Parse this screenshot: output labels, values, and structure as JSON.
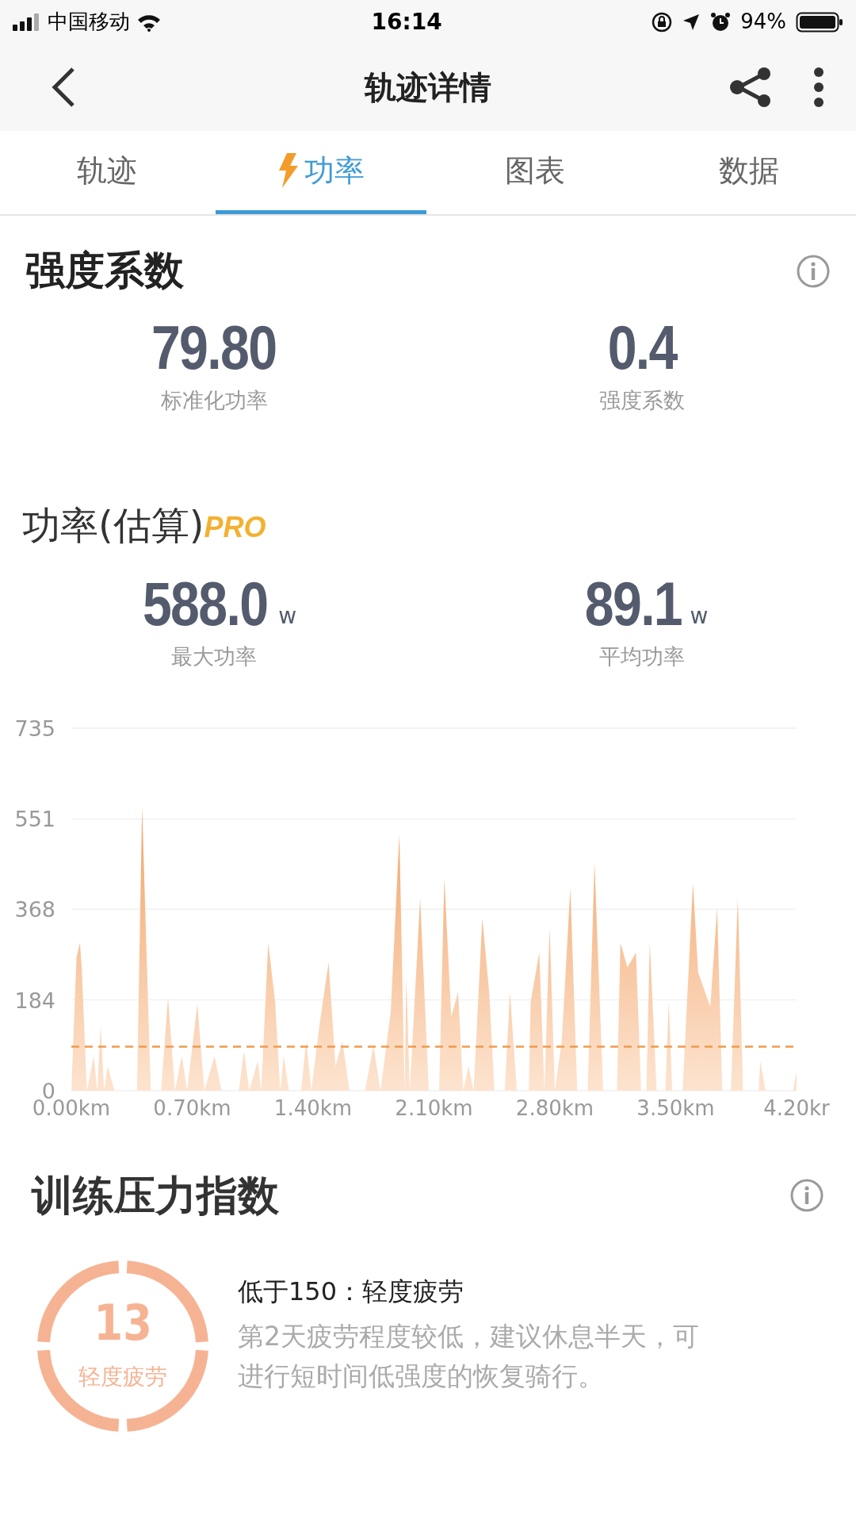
{
  "status_bar": {
    "carrier": "中国移动",
    "time": "16:14",
    "battery": "94%"
  },
  "header": {
    "title": "轨迹详情"
  },
  "tabs": [
    {
      "label": "轨迹",
      "selected": false
    },
    {
      "label": "功率",
      "selected": true
    },
    {
      "label": "图表",
      "selected": false
    },
    {
      "label": "数据",
      "selected": false
    }
  ],
  "intensity": {
    "title": "强度系数",
    "metrics": [
      {
        "value": "79.80",
        "label": "标准化功率"
      },
      {
        "value": "0.4",
        "label": "强度系数"
      }
    ]
  },
  "power": {
    "title": "功率(估算)",
    "badge": "PRO",
    "metrics": [
      {
        "value": "588.0",
        "unit": "w",
        "label": "最大功率"
      },
      {
        "value": "89.1",
        "unit": "w",
        "label": "平均功率"
      }
    ],
    "chart_data": {
      "type": "area",
      "xlim": [
        0,
        4.2
      ],
      "ylim": [
        0,
        735
      ],
      "xticks": [
        {
          "value": 0,
          "label": "0.00km"
        },
        {
          "value": 0.7,
          "label": "0.70km"
        },
        {
          "value": 1.4,
          "label": "1.40km"
        },
        {
          "value": 2.1,
          "label": "2.10km"
        },
        {
          "value": 2.8,
          "label": "2.80km"
        },
        {
          "value": 3.5,
          "label": "3.50km"
        },
        {
          "value": 4.2,
          "label": "4.20kr"
        }
      ],
      "yticks": [
        0,
        184,
        368,
        551,
        735
      ],
      "x": [
        0,
        0.03,
        0.05,
        0.06,
        0.09,
        0.13,
        0.15,
        0.17,
        0.19,
        0.21,
        0.25,
        0.38,
        0.41,
        0.46,
        0.52,
        0.56,
        0.6,
        0.64,
        0.67,
        0.73,
        0.77,
        0.83,
        0.87,
        0.97,
        1.0,
        1.03,
        1.08,
        1.1,
        1.14,
        1.18,
        1.21,
        1.23,
        1.26,
        1.33,
        1.36,
        1.39,
        1.44,
        1.49,
        1.53,
        1.57,
        1.61,
        1.7,
        1.75,
        1.79,
        1.85,
        1.9,
        1.93,
        1.94,
        1.96,
        2.02,
        2.07,
        2.13,
        2.16,
        2.2,
        2.24,
        2.27,
        2.3,
        2.33,
        2.38,
        2.42,
        2.45,
        2.51,
        2.54,
        2.58,
        2.65,
        2.66,
        2.71,
        2.74,
        2.77,
        2.8,
        2.84,
        2.89,
        2.93,
        2.99,
        3.03,
        3.08,
        3.16,
        3.18,
        3.22,
        3.27,
        3.3,
        3.33,
        3.35,
        3.39,
        3.44,
        3.46,
        3.48,
        3.54,
        3.6,
        3.63,
        3.7,
        3.74,
        3.77,
        3.82,
        3.86,
        3.89,
        3.98,
        3.99,
        4.02,
        4.18,
        4.2
      ],
      "series": [
        {
          "color": "#f2a468",
          "values": [
            0,
            270,
            300,
            250,
            0,
            70,
            0,
            130,
            0,
            50,
            0,
            0,
            575,
            0,
            0,
            190,
            0,
            70,
            0,
            175,
            0,
            70,
            0,
            0,
            80,
            0,
            60,
            0,
            300,
            180,
            0,
            70,
            0,
            0,
            100,
            0,
            140,
            260,
            50,
            100,
            0,
            0,
            90,
            0,
            160,
            520,
            0,
            230,
            0,
            390,
            0,
            0,
            430,
            150,
            200,
            0,
            50,
            0,
            350,
            200,
            0,
            0,
            200,
            0,
            0,
            180,
            280,
            0,
            330,
            0,
            100,
            410,
            0,
            0,
            460,
            0,
            0,
            300,
            250,
            280,
            0,
            0,
            300,
            0,
            0,
            180,
            0,
            0,
            420,
            240,
            170,
            370,
            0,
            0,
            390,
            0,
            0,
            60,
            0,
            0,
            40
          ]
        }
      ],
      "grid": true,
      "ref_lines": [
        {
          "axis": "y",
          "value": 89.1
        }
      ]
    }
  },
  "stress": {
    "title": "训练压力指数",
    "score": "13",
    "level_label": "轻度疲劳",
    "headline": "低于150：轻度疲劳",
    "description": "第2天疲劳程度较低，建议休息半天，可进行短时间低强度的恢复骑行。"
  }
}
